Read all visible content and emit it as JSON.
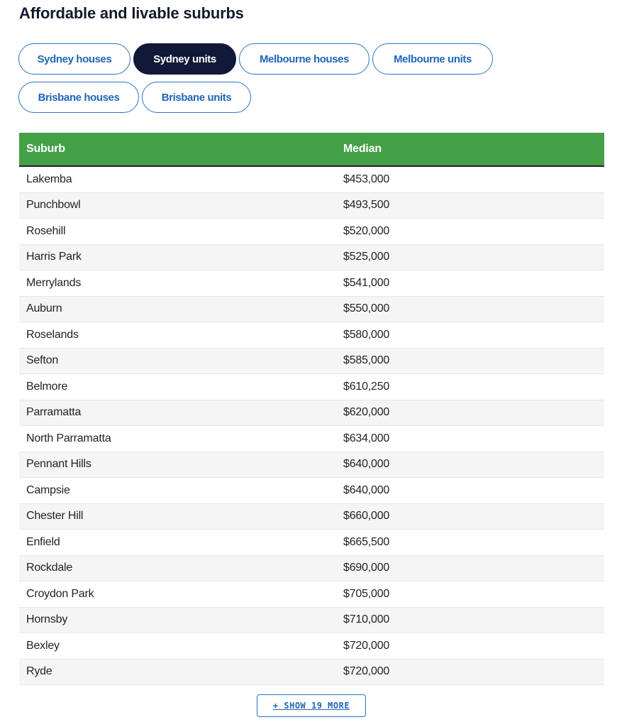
{
  "title": "Affordable and livable suburbs",
  "tabs": [
    {
      "label": "Sydney houses",
      "active": false
    },
    {
      "label": "Sydney units",
      "active": true
    },
    {
      "label": "Melbourne houses",
      "active": false
    },
    {
      "label": "Melbourne units",
      "active": false
    },
    {
      "label": "Brisbane houses",
      "active": false
    },
    {
      "label": "Brisbane units",
      "active": false
    }
  ],
  "table": {
    "headers": [
      "Suburb",
      "Median"
    ],
    "rows": [
      [
        "Lakemba",
        "$453,000"
      ],
      [
        "Punchbowl",
        "$493,500"
      ],
      [
        "Rosehill",
        "$520,000"
      ],
      [
        "Harris Park",
        "$525,000"
      ],
      [
        "Merrylands",
        "$541,000"
      ],
      [
        "Auburn",
        "$550,000"
      ],
      [
        "Roselands",
        "$580,000"
      ],
      [
        "Sefton",
        "$585,000"
      ],
      [
        "Belmore",
        "$610,250"
      ],
      [
        "Parramatta",
        "$620,000"
      ],
      [
        "North Parramatta",
        "$634,000"
      ],
      [
        "Pennant Hills",
        "$640,000"
      ],
      [
        "Campsie",
        "$640,000"
      ],
      [
        "Chester Hill",
        "$660,000"
      ],
      [
        "Enfield",
        "$665,500"
      ],
      [
        "Rockdale",
        "$690,000"
      ],
      [
        "Croydon Park",
        "$705,000"
      ],
      [
        "Hornsby",
        "$710,000"
      ],
      [
        "Bexley",
        "$720,000"
      ],
      [
        "Ryde",
        "$720,000"
      ]
    ]
  },
  "show_more_label": "+ SHOW 19 MORE",
  "colors": {
    "header_green": "#43a047",
    "active_tab": "#101937",
    "accent_blue": "#1f66b8"
  }
}
